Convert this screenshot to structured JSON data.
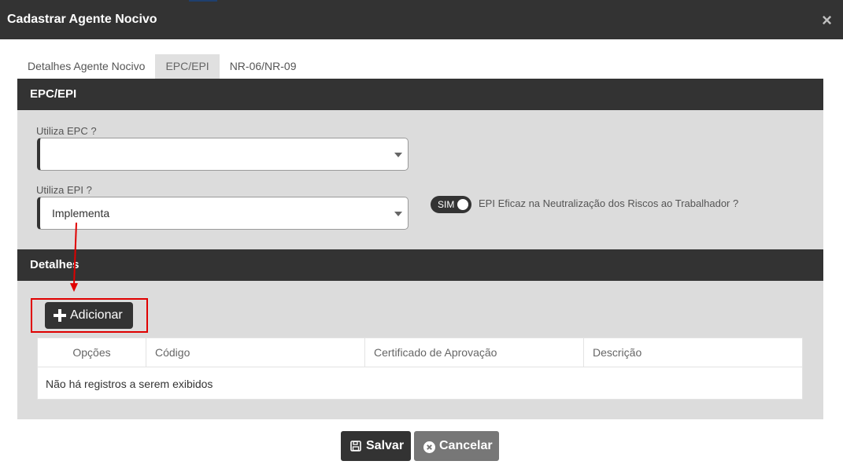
{
  "dialog": {
    "title": "Cadastrar Agente Nocivo",
    "close_icon": "×"
  },
  "tabs": [
    {
      "label": "Detalhes Agente Nocivo",
      "active": false
    },
    {
      "label": "EPC/EPI",
      "active": true
    },
    {
      "label": "NR-06/NR-09",
      "active": false
    }
  ],
  "epc_epi_section": {
    "title": "EPC/EPI",
    "utiliza_epc": {
      "label": "Utiliza EPC ?",
      "value": ""
    },
    "utiliza_epi": {
      "label": "Utiliza EPI ?",
      "value": "Implementa"
    },
    "epi_eficaz": {
      "toggle_text": "SIM",
      "label": "EPI Eficaz na Neutralização dos Riscos ao Trabalhador ?"
    }
  },
  "detalhes_section": {
    "title": "Detalhes",
    "add_button": "Adicionar",
    "table": {
      "columns": [
        "Opções",
        "Código",
        "Certificado de Aprovação",
        "Descrição"
      ],
      "empty_message": "Não há registros a serem exibidos"
    }
  },
  "footer": {
    "save_label": "Salvar",
    "cancel_label": "Cancelar"
  },
  "colors": {
    "header_dark": "#333333",
    "panel_bg": "#dcdcdc",
    "highlight": "#e00000"
  }
}
